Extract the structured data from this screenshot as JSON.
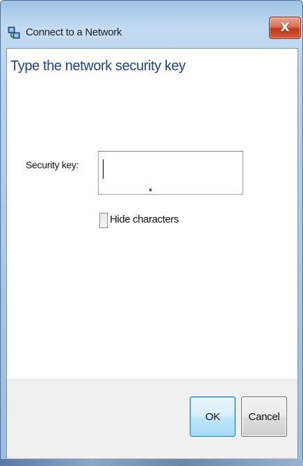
{
  "window": {
    "title": "Connect to a Network",
    "close_label": "X"
  },
  "main": {
    "heading": "Type the network security key",
    "security_key_label": "Security key:",
    "security_key_value": "",
    "hide_characters_label": "Hide characters",
    "hide_characters_checked": false
  },
  "footer": {
    "ok_label": "OK",
    "cancel_label": "Cancel"
  },
  "colors": {
    "heading": "#1e3f8f",
    "frame": "#a9c6e5",
    "close_button": "#c0391d",
    "ok_border": "#3c7fb1"
  },
  "icons": {
    "title_icon": "network-icon",
    "close_icon": "close-icon"
  }
}
